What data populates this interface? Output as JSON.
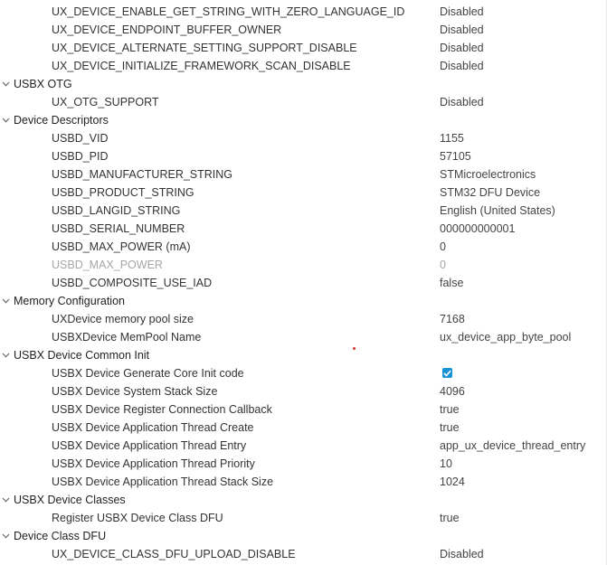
{
  "rows": [
    {
      "type": "param",
      "name": "UX_DEVICE_ENABLE_GET_STRING_WITH_ZERO_LANGUAGE_ID",
      "value": "Disabled"
    },
    {
      "type": "param",
      "name": "UX_DEVICE_ENDPOINT_BUFFER_OWNER",
      "value": "Disabled"
    },
    {
      "type": "param",
      "name": "UX_DEVICE_ALTERNATE_SETTING_SUPPORT_DISABLE",
      "value": "Disabled"
    },
    {
      "type": "param",
      "name": "UX_DEVICE_INITIALIZE_FRAMEWORK_SCAN_DISABLE",
      "value": "Disabled"
    },
    {
      "type": "group",
      "name": "USBX OTG",
      "expanded": true
    },
    {
      "type": "param",
      "name": "UX_OTG_SUPPORT",
      "value": "Disabled"
    },
    {
      "type": "group",
      "name": "Device Descriptors",
      "expanded": true
    },
    {
      "type": "param",
      "name": "USBD_VID",
      "value": "1155"
    },
    {
      "type": "param",
      "name": "USBD_PID",
      "value": "57105"
    },
    {
      "type": "param",
      "name": "USBD_MANUFACTURER_STRING",
      "value": "STMicroelectronics"
    },
    {
      "type": "param",
      "name": "USBD_PRODUCT_STRING",
      "value": "STM32 DFU Device"
    },
    {
      "type": "param",
      "name": "USBD_LANGID_STRING",
      "value": "English (United States)"
    },
    {
      "type": "param",
      "name": "USBD_SERIAL_NUMBER",
      "value": "000000000001"
    },
    {
      "type": "param",
      "name": "USBD_MAX_POWER (mA)",
      "value": "0"
    },
    {
      "type": "param",
      "name": "USBD_MAX_POWER",
      "value": "0",
      "disabled": true
    },
    {
      "type": "param",
      "name": "USBD_COMPOSITE_USE_IAD",
      "value": "false"
    },
    {
      "type": "group",
      "name": "Memory Configuration",
      "expanded": true
    },
    {
      "type": "param",
      "name": "UXDevice memory pool size",
      "value": "7168"
    },
    {
      "type": "param",
      "name": "USBXDevice MemPool Name",
      "value": "ux_device_app_byte_pool"
    },
    {
      "type": "group",
      "name": "USBX Device Common Init",
      "expanded": true
    },
    {
      "type": "param",
      "name": "USBX Device Generate Core Init code",
      "checkbox": true,
      "checked": true
    },
    {
      "type": "param",
      "name": "USBX Device System Stack Size",
      "value": "4096"
    },
    {
      "type": "param",
      "name": "USBX Device Register Connection Callback",
      "value": "true"
    },
    {
      "type": "param",
      "name": "USBX Device Application Thread Create",
      "value": "true"
    },
    {
      "type": "param",
      "name": "USBX Device Application Thread Entry",
      "value": "app_ux_device_thread_entry"
    },
    {
      "type": "param",
      "name": "USBX Device Application Thread Priority",
      "value": "10"
    },
    {
      "type": "param",
      "name": "USBX Device Application Thread Stack Size",
      "value": "1024"
    },
    {
      "type": "group",
      "name": "USBX Device Classes",
      "expanded": true
    },
    {
      "type": "param",
      "name": "Register USBX Device Class DFU",
      "value": "true"
    },
    {
      "type": "group",
      "name": "Device Class DFU",
      "expanded": true
    },
    {
      "type": "param",
      "name": "UX_DEVICE_CLASS_DFU_UPLOAD_DISABLE",
      "value": "Disabled"
    }
  ],
  "icons": {
    "group_toggle": "chevron-down-icon",
    "checkbox_mark": "checkmark-icon"
  },
  "colors": {
    "checkbox_fill": "#1a92d6",
    "disabled_text": "#a6a6a6",
    "stray_dot": "#d23434"
  }
}
